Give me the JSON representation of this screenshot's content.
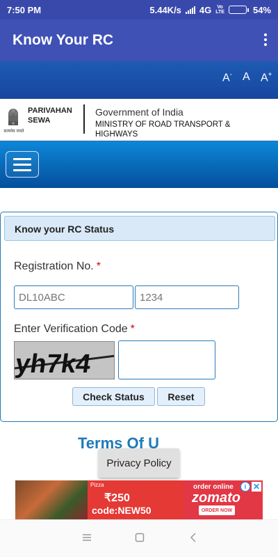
{
  "status_bar": {
    "time": "7:50 PM",
    "speed": "5.44K/s",
    "network": "4G",
    "volte": "Vo LTE",
    "battery": "54%",
    "battery_level": 0.54
  },
  "app_bar": {
    "title": "Know Your RC",
    "menu_icon": "overflow-menu-icon"
  },
  "font_controls": {
    "decrease": "A",
    "decrease_sup": "-",
    "normal": "A",
    "increase": "A",
    "increase_sup": "+"
  },
  "header": {
    "brand_line1": "PARIVAHAN",
    "brand_line2": "SEWA",
    "emblem_text": "सत्यमेव जयते",
    "gov": "Government of India",
    "ministry": "MINISTRY OF ROAD TRANSPORT & HIGHWAYS"
  },
  "nav": {
    "menu_icon": "hamburger-icon"
  },
  "form": {
    "panel_title": "Know your RC Status",
    "registration_label": "Registration No.",
    "required_mark": "*",
    "reg_part1_placeholder": "DL10ABC",
    "reg_part2_placeholder": "1234",
    "verification_label": "Enter Verification Code",
    "captcha_text": "yh7k4",
    "verification_value": "",
    "check_status_label": "Check Status",
    "reset_label": "Reset"
  },
  "partial_heading": "Terms Of U",
  "privacy_label": "Privacy Policy",
  "ad": {
    "pizza": "Pizza",
    "price": "₹250",
    "code": "code:NEW50",
    "order_online": "order online",
    "brand": "zomato",
    "order_now": "ORDER NOW",
    "info_icon": "info-icon",
    "close_icon": "close-icon",
    "colors": {
      "primary": "#e23744"
    }
  },
  "system_nav": {
    "recents": "menu-icon",
    "home": "home-square-icon",
    "back": "back-chevron-icon"
  },
  "colors": {
    "status_bar": "#3949ab",
    "app_bar": "#3f51b5",
    "accent": "#1e7ab8",
    "required": "#d0021b"
  }
}
